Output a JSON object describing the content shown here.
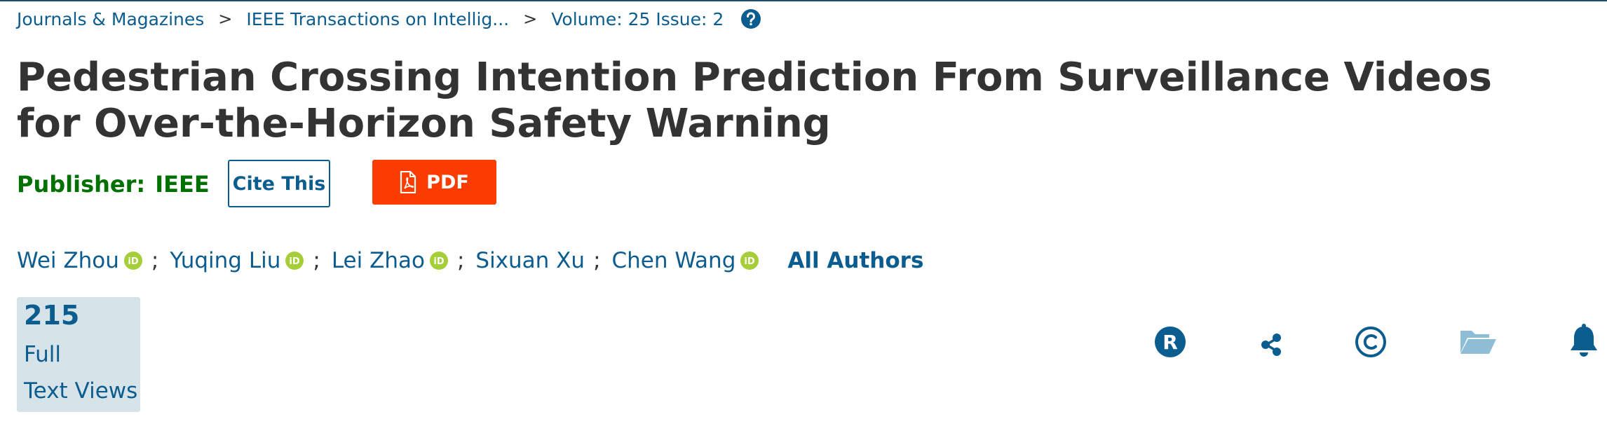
{
  "breadcrumb": {
    "items": [
      "Journals & Magazines",
      "IEEE Transactions on Intellig...",
      "Volume: 25 Issue: 2"
    ],
    "separator": ">"
  },
  "article": {
    "title": "Pedestrian Crossing Intention Prediction From Surveillance Videos for Over-the-Horizon Safety Warning"
  },
  "publisher": {
    "label": "Publisher:",
    "value": "IEEE"
  },
  "buttons": {
    "cite_label": "Cite This",
    "pdf_label": "PDF"
  },
  "authors": {
    "list": [
      {
        "name": "Wei Zhou",
        "orcid": true
      },
      {
        "name": "Yuqing Liu",
        "orcid": true
      },
      {
        "name": "Lei Zhao",
        "orcid": true
      },
      {
        "name": "Sixuan Xu",
        "orcid": false
      },
      {
        "name": "Chen Wang",
        "orcid": true
      }
    ],
    "separator": ";",
    "all_authors_label": "All Authors"
  },
  "metrics": {
    "count": "215",
    "label_line1": "Full",
    "label_line2": "Text Views"
  },
  "colors": {
    "link": "#0b5c8f",
    "publisher": "#007000",
    "pdf_button": "#fa3c00",
    "metric_bg": "#d6e4ea",
    "orcid": "#a6ce39"
  },
  "actions": [
    {
      "icon": "rights-permissions-icon"
    },
    {
      "icon": "share-icon"
    },
    {
      "icon": "copyright-icon"
    },
    {
      "icon": "folder-icon"
    },
    {
      "icon": "alert-bell-icon"
    }
  ]
}
